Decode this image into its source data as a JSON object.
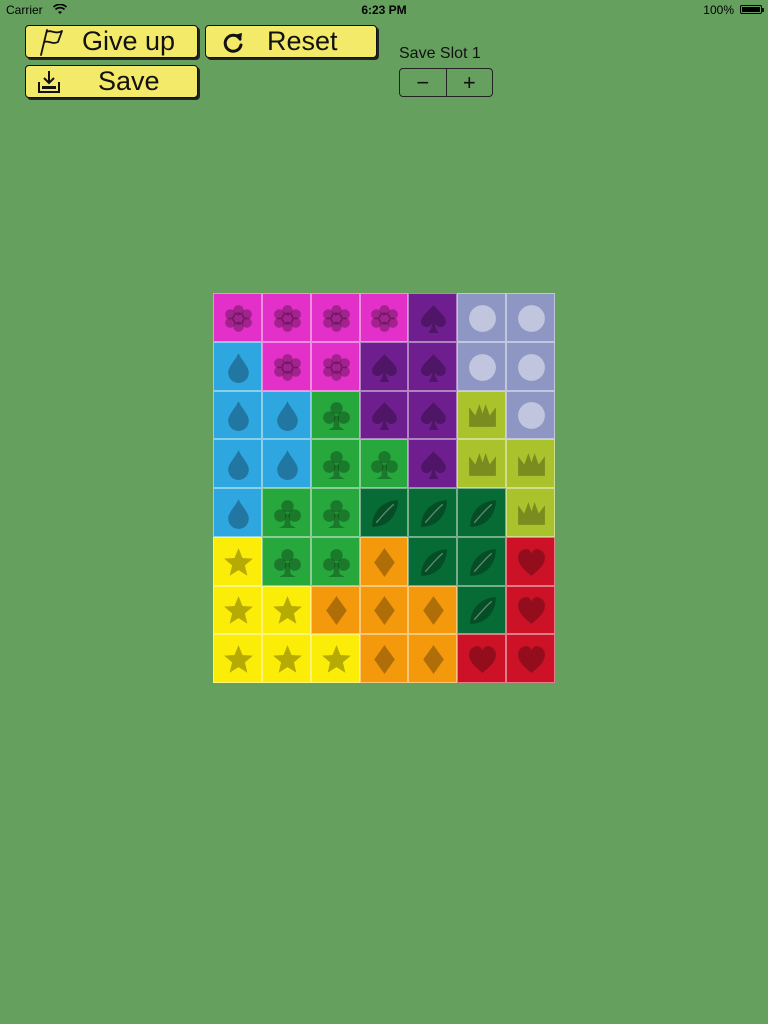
{
  "status_bar": {
    "carrier": "Carrier",
    "time": "6:23 PM",
    "battery": "100%"
  },
  "buttons": {
    "give_up": {
      "label": "Give up",
      "icon": "flag-icon"
    },
    "reset": {
      "label": "Reset",
      "icon": "reset-icon"
    },
    "save": {
      "label": "Save",
      "icon": "download-tray-icon"
    }
  },
  "save_slot": {
    "label": "Save Slot 1",
    "minus": "−",
    "plus": "+"
  },
  "board": {
    "columns": 7,
    "rows": 8,
    "pieces": {
      "flower": {
        "fill": "#e230c8",
        "icon": "flower-icon"
      },
      "spade": {
        "fill": "#6e1e8e",
        "icon": "spade-icon"
      },
      "circle": {
        "fill": "#8e97c4",
        "icon": "circle-icon"
      },
      "drop": {
        "fill": "#2ea6e0",
        "icon": "drop-icon"
      },
      "club": {
        "fill": "#26a83c",
        "icon": "club-icon"
      },
      "crown": {
        "fill": "#aac32c",
        "icon": "crown-icon"
      },
      "leaf": {
        "fill": "#066b34",
        "icon": "leaf-icon"
      },
      "star": {
        "fill": "#fced08",
        "icon": "star-icon"
      },
      "diamond": {
        "fill": "#f4990c",
        "icon": "diamond-icon"
      },
      "heart": {
        "fill": "#cd1228",
        "icon": "heart-icon"
      }
    },
    "grid": [
      [
        "flower",
        "flower",
        "flower",
        "flower",
        "spade",
        "circle",
        "circle"
      ],
      [
        "drop",
        "flower",
        "flower",
        "spade",
        "spade",
        "circle",
        "circle"
      ],
      [
        "drop",
        "drop",
        "club",
        "spade",
        "spade",
        "crown",
        "circle"
      ],
      [
        "drop",
        "drop",
        "club",
        "club",
        "spade",
        "crown",
        "crown"
      ],
      [
        "drop",
        "club",
        "club",
        "leaf",
        "leaf",
        "leaf",
        "crown"
      ],
      [
        "star",
        "club",
        "club",
        "diamond",
        "leaf",
        "leaf",
        "heart"
      ],
      [
        "star",
        "star",
        "diamond",
        "diamond",
        "diamond",
        "leaf",
        "heart"
      ],
      [
        "star",
        "star",
        "star",
        "diamond",
        "diamond",
        "heart",
        "heart"
      ]
    ]
  }
}
